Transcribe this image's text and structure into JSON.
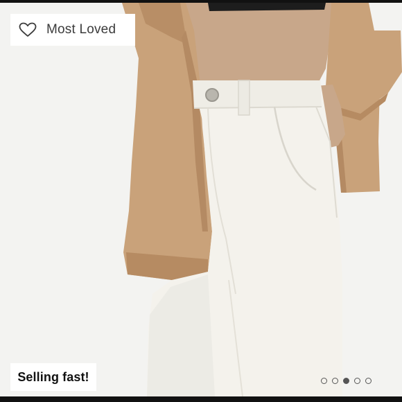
{
  "badge_top": {
    "label": "Most Loved",
    "icon": "heart-outline-icon"
  },
  "badge_bottom": {
    "label": "Selling fast!"
  },
  "carousel": {
    "total": 5,
    "active_index": 2
  },
  "colors": {
    "background": "#f3f3f1",
    "shirt": "#c9a27a",
    "skin": "#c8a78a",
    "jeans": "#f4f2ec"
  }
}
